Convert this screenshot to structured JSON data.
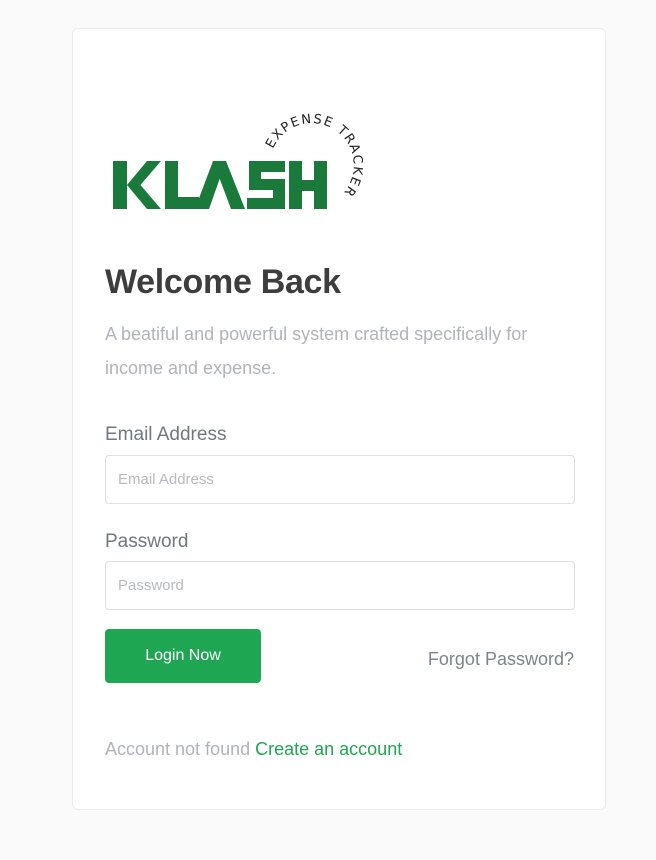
{
  "brand": {
    "logo_text": "KLASH",
    "logo_tagline": "EXPENSE TRACKER",
    "logo_color": "#1a7a3c"
  },
  "heading": {
    "title": "Welcome Back",
    "subtitle": "A beatiful and powerful system crafted specifically for income and expense."
  },
  "form": {
    "email_label": "Email Address",
    "email_placeholder": "Email Address",
    "email_value": "",
    "password_label": "Password",
    "password_placeholder": "Password",
    "password_value": "",
    "login_label": "Login Now",
    "forgot_label": "Forgot Password?"
  },
  "footer": {
    "prompt": "Account not found",
    "create_label": "Create an account"
  },
  "colors": {
    "accent": "#1fa652",
    "title": "#3d3d3d",
    "muted": "#b0b4ba"
  }
}
